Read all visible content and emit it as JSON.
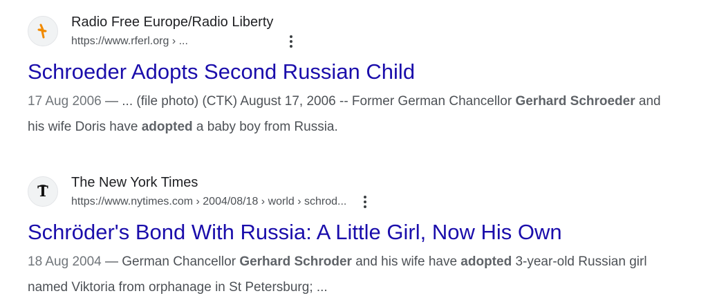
{
  "results": [
    {
      "favicon": "rferl-logo-icon",
      "site_name": "Radio Free Europe/Radio Liberty",
      "url": "https://www.rferl.org › ...",
      "title": "Schroeder Adopts Second Russian Child",
      "snippet": {
        "date": "17 Aug 2006",
        "sep": " — ",
        "parts": [
          {
            "text": "... (file photo) (CTK) August 17, 2006 -- Former German Chancellor ",
            "bold": false
          },
          {
            "text": "Gerhard Schroeder",
            "bold": true
          },
          {
            "text": " and his wife Doris have ",
            "bold": false
          },
          {
            "text": "adopted",
            "bold": true
          },
          {
            "text": " a baby boy from Russia.",
            "bold": false
          }
        ]
      }
    },
    {
      "favicon": "nyt-logo-icon",
      "site_name": "The New York Times",
      "url": "https://www.nytimes.com › 2004/08/18 › world › schrod...",
      "title": "Schröder's Bond With Russia: A Little Girl, Now His Own",
      "snippet": {
        "date": "18 Aug 2004",
        "sep": " — ",
        "parts": [
          {
            "text": "German Chancellor ",
            "bold": false
          },
          {
            "text": "Gerhard Schroder",
            "bold": true
          },
          {
            "text": " and his wife have ",
            "bold": false
          },
          {
            "text": "adopted",
            "bold": true
          },
          {
            "text": " 3-year-old Russian girl named Viktoria from orphanage in St Petersburg; ...",
            "bold": false
          }
        ]
      }
    }
  ],
  "icons": {
    "more": "three-dots-vertical-icon"
  },
  "colors": {
    "link": "#1a0dab",
    "text": "#4d5156",
    "site": "#202124",
    "rferl_orange": "#f18a00"
  }
}
